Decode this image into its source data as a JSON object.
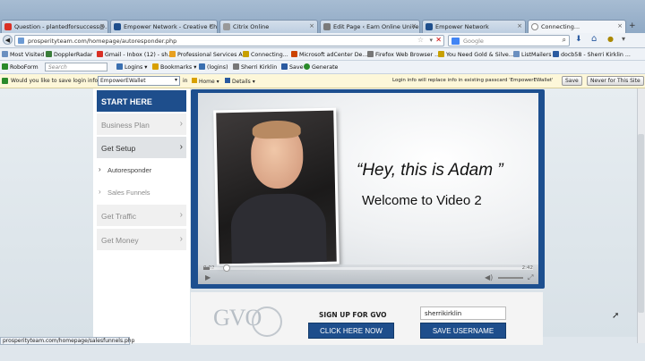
{
  "tabs": [
    {
      "label": "Question - plantedforsuccess@...",
      "active": false
    },
    {
      "label": "Empower Network - Creative Ch...",
      "active": false
    },
    {
      "label": "Citrix Online",
      "active": false
    },
    {
      "label": "Edit Page ‹ Earn Online Universit...",
      "active": false
    },
    {
      "label": "Empower Network",
      "active": false
    },
    {
      "label": "Connecting...",
      "active": true
    }
  ],
  "nav": {
    "url": "prosperityteam.com/homepage/autoresponder.php",
    "search_placeholder": "Google"
  },
  "bookmarks": [
    "Most Visited",
    "DopplerRadar",
    "Gmail - Inbox (12) - sh...",
    "Professional Services A...",
    "Connecting...",
    "Microsoft adCenter De...",
    "Firefox Web Browser ...",
    "You Need Gold & Silve...",
    "ListMailers",
    "docb58 - Sherri Kirklin ..."
  ],
  "roboform": {
    "label": "RoboForm",
    "search_placeholder": "Search",
    "items": [
      "Logins",
      "Bookmarks",
      "(logins)",
      "Sherri Kirklin",
      "Save",
      "Generate"
    ]
  },
  "savebar": {
    "prompt": "Would you like to save login info as:",
    "value": "EmpowerEWallet",
    "in": "in",
    "home": "Home",
    "details": "Details",
    "info": "Login info will replace info in existing passcard 'EmpowerEWallet'",
    "save": "Save",
    "never": "Never for This Site"
  },
  "sidebar": {
    "start": "START HERE",
    "items": [
      {
        "label": "Business Plan",
        "type": "menu"
      },
      {
        "label": "Get Setup",
        "type": "menu"
      },
      {
        "label": "Autoresponder",
        "type": "sub"
      },
      {
        "label": "Sales Funnels",
        "type": "sub"
      },
      {
        "label": "Get Traffic",
        "type": "menu"
      },
      {
        "label": "Get Money",
        "type": "menu"
      }
    ]
  },
  "video": {
    "quote": "“Hey, this is Adam ”",
    "welcome": "Welcome to Video 2",
    "time_current": "0:02",
    "time_total": "2:42",
    "progress": 0.02
  },
  "panel": {
    "logo": "GVO",
    "signup": "SIGN UP FOR GVO",
    "click": "CLICK HERE NOW",
    "username": "sherrikirklin",
    "save": "SAVE USERNAME"
  },
  "status": "prosperityteam.com/homepage/salesfunnels.php",
  "colors": {
    "brand_blue": "#1e4e8c"
  }
}
